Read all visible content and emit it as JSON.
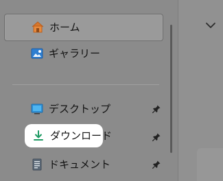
{
  "window": {
    "background": "#8f8f8f"
  },
  "sidebar": {
    "items": [
      {
        "label": "ホーム",
        "icon": "home-icon",
        "selected": true
      },
      {
        "label": "ギャラリー",
        "icon": "gallery-icon",
        "selected": false
      },
      {
        "label": "デスクトップ",
        "icon": "desktop-icon",
        "pinned": true
      },
      {
        "label": "ダウンロード",
        "icon": "download-icon",
        "pinned": true,
        "highlighted": true
      },
      {
        "label": "ドキュメント",
        "icon": "document-icon",
        "pinned": true
      }
    ]
  },
  "right_panel": {
    "expand_icon": "chevron-down-icon"
  },
  "colors": {
    "home_orange": "#f28a2e",
    "gallery_blue": "#2f7fd1",
    "desktop_blue": "#2e91d7",
    "download_green": "#1e9a63",
    "document_gray": "#5d6a78",
    "highlight_white": "#ffffff"
  }
}
